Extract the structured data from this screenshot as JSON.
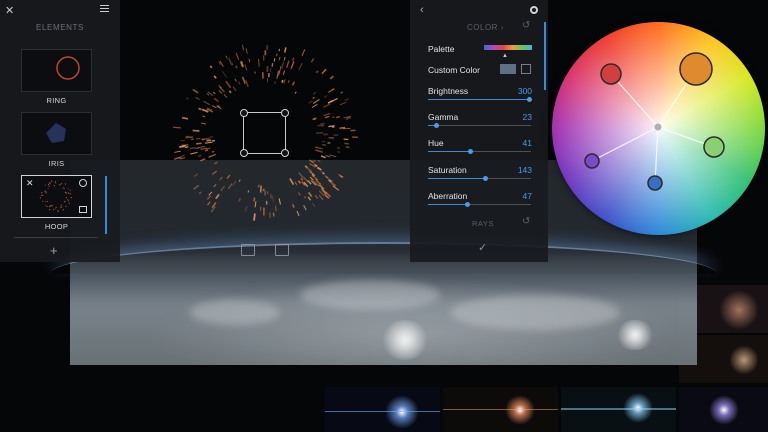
{
  "elements_panel": {
    "title": "ELEMENTS",
    "items": [
      {
        "label": "RING"
      },
      {
        "label": "IRIS"
      },
      {
        "label": "HOOP"
      }
    ],
    "add_label": "+"
  },
  "color_panel": {
    "back_label": "‹",
    "title": "COLOR",
    "palette_label": "Palette",
    "custom_color_label": "Custom Color",
    "custom_color_hex": "#5e6f86",
    "sliders": [
      {
        "label": "Brightness",
        "value": "300",
        "fraction": 0.98
      },
      {
        "label": "Gamma",
        "value": "23",
        "fraction": 0.08
      },
      {
        "label": "Hue",
        "value": "41",
        "fraction": 0.41
      },
      {
        "label": "Saturation",
        "value": "143",
        "fraction": 0.55
      },
      {
        "label": "Aberration",
        "value": "47",
        "fraction": 0.38
      }
    ],
    "next_section": "RAYS",
    "confirm_label": "✓"
  },
  "colors": {
    "accent": "#3a8ad8",
    "panel_bg": "#181a1e"
  },
  "color_wheel": {
    "handles": [
      {
        "color": "#d04040",
        "role": "shadow"
      },
      {
        "color": "#e08a30",
        "role": "highlight"
      },
      {
        "color": "#8ad070",
        "role": "mid"
      },
      {
        "color": "#7a4ac8",
        "role": "low"
      },
      {
        "color": "#3a6ec0",
        "role": "base"
      }
    ]
  }
}
